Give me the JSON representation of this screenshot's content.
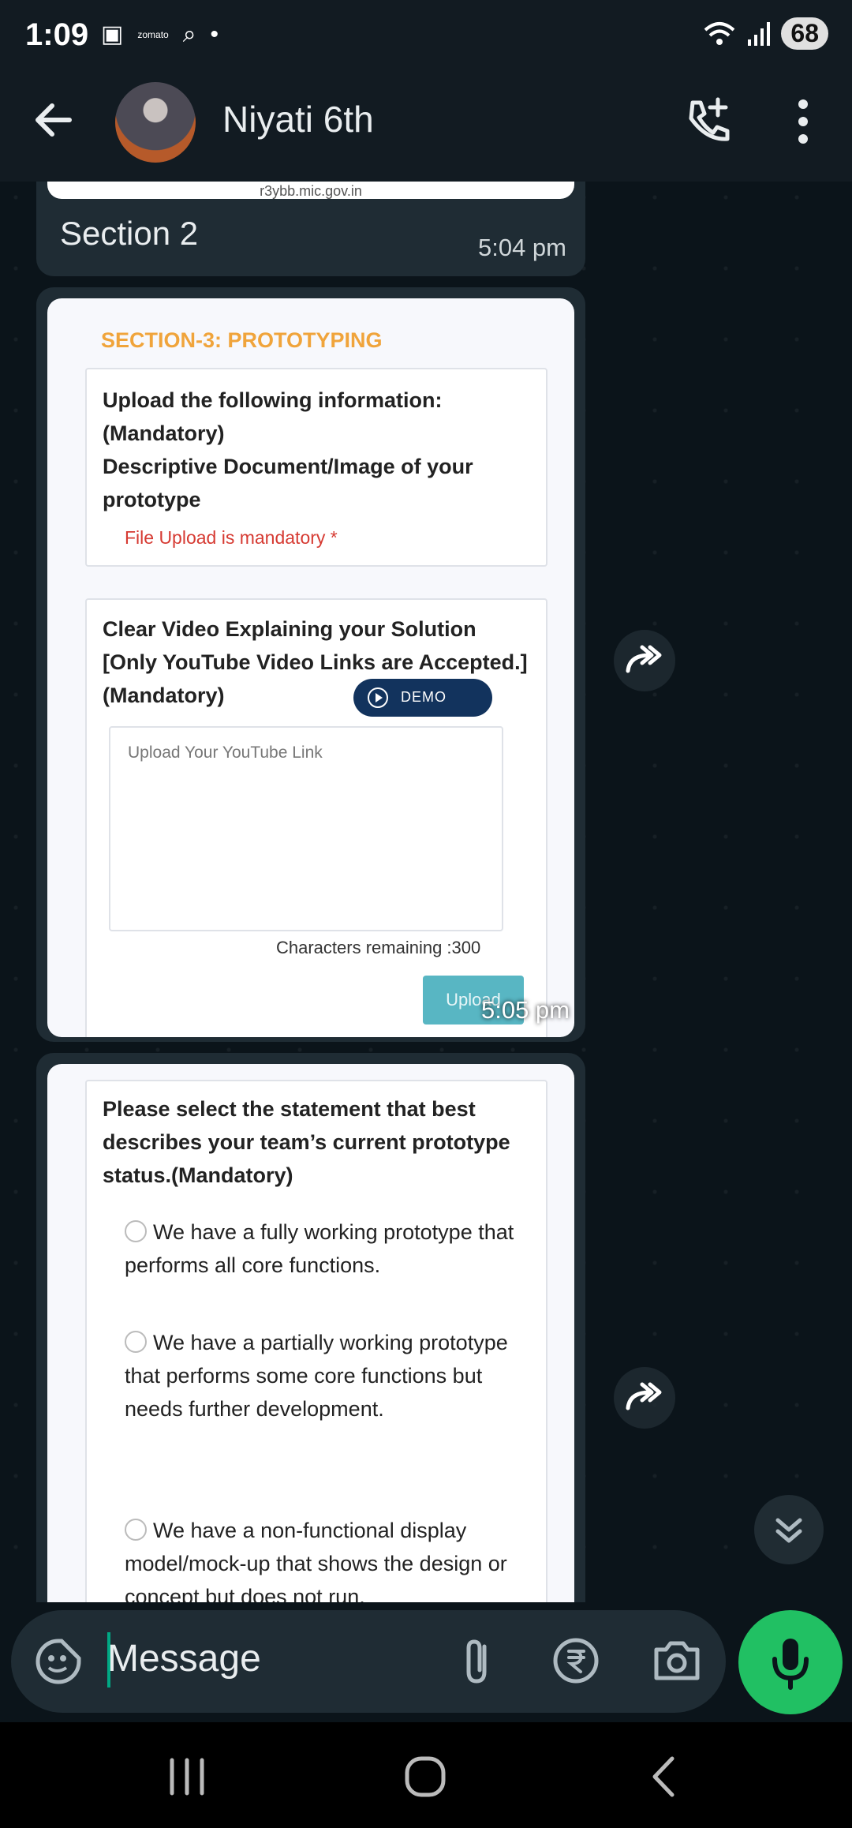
{
  "status_bar": {
    "time": "1:09",
    "zomato": "zomato",
    "battery": "68"
  },
  "header": {
    "contact_name": "Niyati 6th"
  },
  "messages": {
    "m1": {
      "url_fragment": "r3ybb.mic.gov.in",
      "text": "Section 2",
      "time": "5:04 pm"
    },
    "m2": {
      "section_title": "SECTION-3: PROTOTYPING",
      "card1_question": "Upload the following information:(Mandatory)\nDescriptive Document/Image of your prototype",
      "card1_required": "File Upload is mandatory *",
      "card2_question": "Clear Video Explaining your Solution [Only YouTube Video Links are Accepted.](Mandatory)",
      "demo_label": "DEMO",
      "link_placeholder": "Upload Your YouTube Link",
      "chars_remaining": "Characters remaining :300",
      "upload_label": "Upload",
      "time": "5:05 pm"
    },
    "m3": {
      "question": "Please select the statement that best describes your team’s current prototype status.(Mandatory)",
      "options": [
        "We have a fully working prototype that performs all core functions.",
        "We have a partially working prototype that performs some core functions but needs further development.",
        "We have a non-functional display model/mock-up that shows the design or concept but does not run."
      ]
    }
  },
  "composer": {
    "placeholder": "Message"
  },
  "colors": {
    "accent": "#21c063",
    "bubble": "#1f2c34",
    "header": "#121b22",
    "section_orange": "#f0a43b",
    "required_red": "#d63a32"
  }
}
